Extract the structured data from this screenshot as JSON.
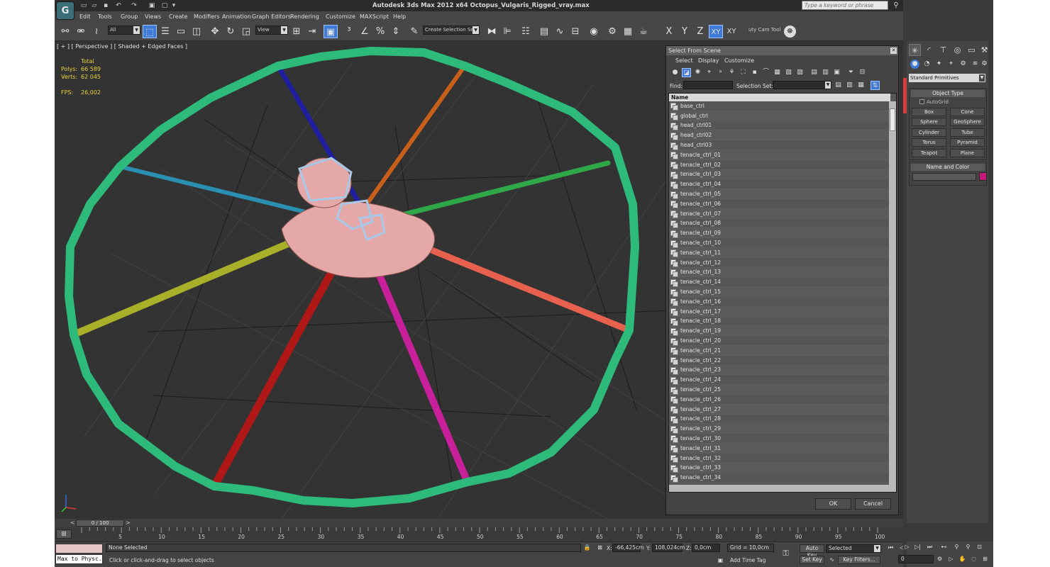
{
  "app": {
    "title": "Autodesk 3ds Max  2012 x64     Octopus_Vulgaris_Rigged_vray.max",
    "logo": "G",
    "search_placeholder": "Type a keyword or phrase"
  },
  "menu": [
    "Edit",
    "Tools",
    "Group",
    "Views",
    "Create",
    "Modifiers",
    "Animation",
    "Graph Editors",
    "Rendering",
    "Customize",
    "MAXScript",
    "Help"
  ],
  "toolbar": {
    "filter_value": "All",
    "refcoord_value": "View",
    "named_sel_value": "Create Selection Se",
    "camera_tool_label": "uty Cam Tool",
    "axis_x": "X",
    "axis_y": "Y",
    "axis_z": "Z",
    "axis_xy": "XY",
    "axis_xy2": "XY"
  },
  "viewport": {
    "label": "[ + ] [ Perspective ] [ Shaded + Edged Faces ]",
    "stats_header": "Total",
    "polys_label": "Polys:",
    "polys_value": "66 589",
    "verts_label": "Verts:",
    "verts_value": "62 045",
    "fps_label": "FPS:",
    "fps_value": "26,002"
  },
  "dialog": {
    "title": "Select From Scene",
    "menu": [
      "Select",
      "Display",
      "Customize"
    ],
    "find_label": "Find:",
    "selection_set_label": "Selection Set:",
    "column_header": "Name",
    "items": [
      "base_ctrl",
      "global_ctrl",
      "head_ctrl01",
      "head_ctrl02",
      "head_ctrl03",
      "tenacle_ctrl_01",
      "tenacle_ctrl_02",
      "tenacle_ctrl_03",
      "tenacle_ctrl_04",
      "tenacle_ctrl_05",
      "tenacle_ctrl_06",
      "tenacle_ctrl_07",
      "tenacle_ctrl_08",
      "tenacle_ctrl_09",
      "tenacle_ctrl_10",
      "tenacle_ctrl_11",
      "tenacle_ctrl_12",
      "tenacle_ctrl_13",
      "tenacle_ctrl_14",
      "tenacle_ctrl_15",
      "tenacle_ctrl_16",
      "tenacle_ctrl_17",
      "tenacle_ctrl_18",
      "tenacle_ctrl_19",
      "tenacle_ctrl_20",
      "tenacle_ctrl_21",
      "tenacle_ctrl_22",
      "tenacle_ctrl_23",
      "tenacle_ctrl_24",
      "tenacle_ctrl_25",
      "tenacle_ctrl_26",
      "tenacle_ctrl_27",
      "tenacle_ctrl_28",
      "tenacle_ctrl_29",
      "tenacle_ctrl_30",
      "tenacle_ctrl_31",
      "tenacle_ctrl_32",
      "tenacle_ctrl_33",
      "tenacle_ctrl_34"
    ],
    "ok_label": "OK",
    "cancel_label": "Cancel"
  },
  "command_panel": {
    "category_value": "Standard Primitives",
    "object_type_title": "Object Type",
    "autogrid_label": "AutoGrid",
    "buttons": [
      "Box",
      "Cone",
      "Sphere",
      "GeoSphere",
      "Cylinder",
      "Tube",
      "Torus",
      "Pyramid",
      "Teapot",
      "Plane"
    ],
    "name_color_title": "Name and Color",
    "swatch_color": "#c4197a"
  },
  "timeline": {
    "slider_label": "0 / 100",
    "ticks": [
      "0",
      "5",
      "10",
      "15",
      "20",
      "25",
      "30",
      "35",
      "40",
      "45",
      "50",
      "55",
      "60",
      "65",
      "70",
      "75",
      "80",
      "85",
      "90",
      "95",
      "100"
    ]
  },
  "status": {
    "maxscript_text": "Max to Physc.",
    "selection_text": "None Selected",
    "prompt_text": "Click or click-and-drag to select objects",
    "x_label": "X:",
    "x_value": "-66,425cm",
    "y_label": "Y:",
    "y_value": "108,024cm",
    "z_label": "Z:",
    "z_value": "0,0cm",
    "grid_text": "Grid = 10,0cm",
    "add_time_tag": "Add Time Tag",
    "auto_key": "Auto Key",
    "set_key": "Set Key",
    "selected_value": "Selected",
    "key_filters": "Key Filters...",
    "frame_value": "0"
  },
  "colors": {
    "ring": "#2dba7a",
    "tentacle_blue": "#1f1fa0",
    "tentacle_orange": "#c8601c",
    "tentacle_green": "#2fa84a",
    "tentacle_salmon": "#e8604e",
    "tentacle_magenta": "#c8209a",
    "tentacle_red": "#b01818",
    "tentacle_olive": "#a8b02a",
    "tentacle_teal": "#2a8fb0",
    "body": "#e4a8a8"
  }
}
